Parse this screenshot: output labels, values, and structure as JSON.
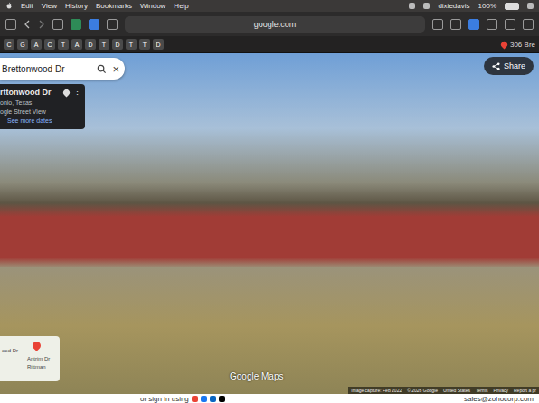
{
  "menu_bar": {
    "items": [
      "Edit",
      "View",
      "History",
      "Bookmarks",
      "Window",
      "Help"
    ],
    "user": "dixiedavis",
    "battery": "100%"
  },
  "toolbar": {
    "address": "google.com"
  },
  "favorites": [
    "C",
    "G",
    "A",
    "C",
    "T",
    "A",
    "D",
    "T",
    "D",
    "T",
    "T",
    "D"
  ],
  "tab": {
    "label": "306 Bre"
  },
  "street_view": {
    "search": {
      "value": "Brettonwood Dr",
      "clear": "×"
    },
    "info_card": {
      "title": "rttonwood Dr",
      "subtitle": "onio, Texas",
      "source": "ogle Street View",
      "more_dates": "See more dates"
    },
    "share": "Share",
    "minimap": {
      "labels": [
        "ood Dr",
        "Antrim Dr",
        "Rittman"
      ]
    },
    "watermark": "Google Maps",
    "footer": [
      "Image capture: Feb 2022",
      "© 2026 Google",
      "United States",
      "Terms",
      "Privacy",
      "Report a pr"
    ]
  },
  "page_footer": {
    "text": "or sign in using",
    "email": "sales@zohocorp.com"
  }
}
